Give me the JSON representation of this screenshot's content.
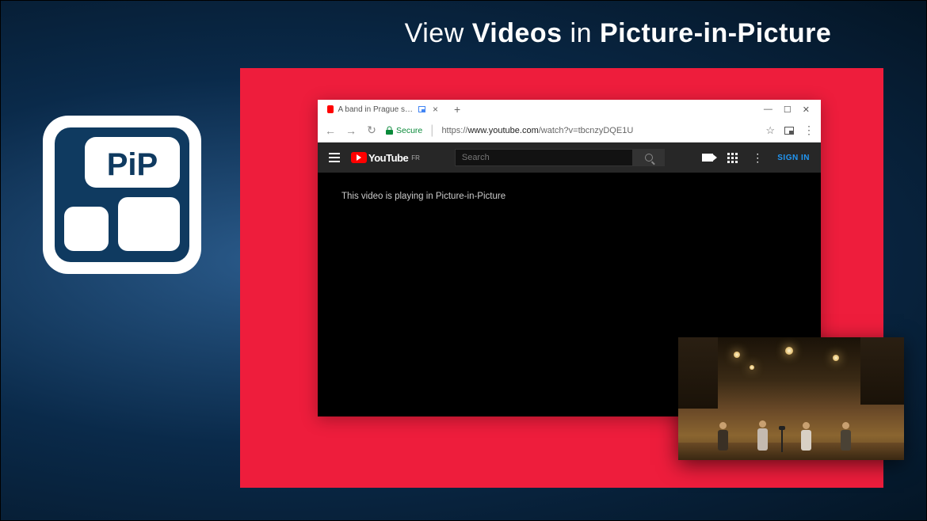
{
  "headline": {
    "pre": "View ",
    "w1": "Videos",
    "mid": " in ",
    "w2": "Picture-in-Picture"
  },
  "pip_logo_text": "PiP",
  "browser": {
    "tab_title": "A band in Prague sings th",
    "tab_close": "×",
    "new_tab": "+",
    "win": {
      "min": "—",
      "max": "☐",
      "close": "✕"
    },
    "nav": {
      "back": "←",
      "fwd": "→",
      "reload": "↻"
    },
    "secure": "Secure",
    "url_prefix": "https://",
    "url_domain": "www.youtube.com",
    "url_path": "/watch?v=tbcnzyDQE1U",
    "star": "☆",
    "kebab": "⋮"
  },
  "youtube": {
    "brand": "YouTube",
    "region": "FR",
    "search_placeholder": "Search",
    "kebab": "⋮",
    "signin": "SIGN IN"
  },
  "video_message": "This video is playing in Picture-in-Picture"
}
